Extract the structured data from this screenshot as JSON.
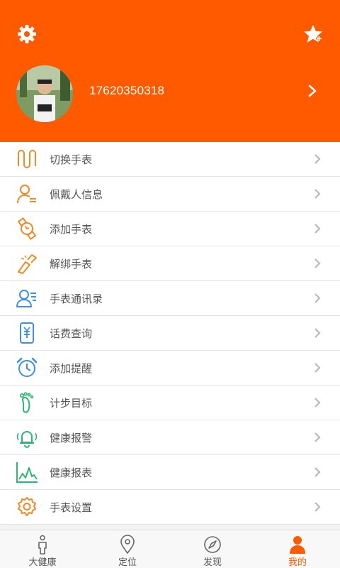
{
  "profile": {
    "phone": "17620350318"
  },
  "menu": [
    {
      "label": "切换手表",
      "icon": "switch-watch-icon"
    },
    {
      "label": "佩戴人信息",
      "icon": "wearer-info-icon"
    },
    {
      "label": "添加手表",
      "icon": "add-watch-icon"
    },
    {
      "label": "解绑手表",
      "icon": "unbind-watch-icon"
    },
    {
      "label": "手表通讯录",
      "icon": "contacts-icon"
    },
    {
      "label": "话费查询",
      "icon": "phone-bill-icon"
    },
    {
      "label": "添加提醒",
      "icon": "alarm-clock-icon"
    },
    {
      "label": "计步目标",
      "icon": "footprint-icon"
    },
    {
      "label": "健康报警",
      "icon": "bell-alarm-icon"
    },
    {
      "label": "健康报表",
      "icon": "chart-icon"
    },
    {
      "label": "手表设置",
      "icon": "gear-icon"
    }
  ],
  "tabs": [
    {
      "label": "大健康",
      "icon": "person-icon",
      "active": false
    },
    {
      "label": "定位",
      "icon": "location-pin-icon",
      "active": false
    },
    {
      "label": "发现",
      "icon": "compass-icon",
      "active": false
    },
    {
      "label": "我的",
      "icon": "user-icon",
      "active": true
    }
  ],
  "colors": {
    "accent": "#ff5a00",
    "orange_icon": "#f08a24",
    "blue_icon": "#3d8fe0",
    "green_icon": "#2bb673"
  }
}
